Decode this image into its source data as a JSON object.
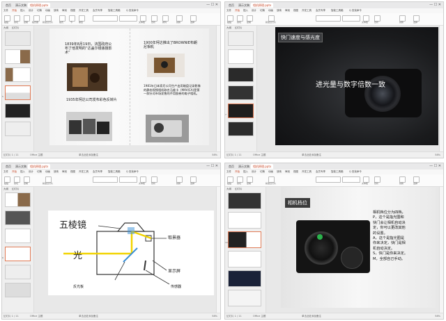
{
  "window": {
    "tabs": [
      {
        "label": "首页"
      },
      {
        "label": "演示文稿"
      },
      {
        "label": "相机原理.pptx"
      }
    ],
    "controls": "— ☐ ✕"
  },
  "menus": [
    "文件",
    "开始",
    "插入",
    "设计",
    "切换",
    "动画",
    "放映",
    "审阅",
    "视图",
    "开发工具",
    "会员专享",
    "智能工具箱",
    "Q 查找命令"
  ],
  "toolbar_labels": [
    "粘贴",
    "剪切",
    "复制",
    "格式刷",
    "新建幻灯片",
    "版式",
    "节",
    "重置",
    "字体",
    "段落",
    "文本框",
    "形状",
    "排列",
    "替换",
    "选择"
  ],
  "sidebar": {
    "tab_outline": "大纲",
    "tab_slides": "幻灯片"
  },
  "status": {
    "slide": "幻灯片 1 / 11",
    "theme": "Office 主题",
    "note": "单击此处添加备注",
    "zoom": "58%"
  },
  "q1": {
    "current": "5",
    "captions": [
      "1839年8月19日，法国政府公布了他发明的“达盖尔银版摄影术”",
      "1900年柯达推出了BROWNIE布朗尼相机",
      "1935年柯达公司发布彩色反转片",
      "1981年日本索尼公司生产出用磁盘记录影像的静态视频相机取名马维卡（MAVICA)是第一款针对市场发售的不用胶卷的电子相机。"
    ]
  },
  "q2": {
    "current": "7",
    "title": "快门速度与感光度",
    "subtitle": "进光量与数字倍数一致"
  },
  "q3": {
    "current": "6",
    "labels": {
      "pentaprism": "五棱镜",
      "light": "光",
      "viewfinder": "取景器",
      "display": "显示屏",
      "mirror": "反光板",
      "sensor": "传感器"
    }
  },
  "q4": {
    "current": "10",
    "title": "相机档位",
    "body_lines": [
      "相机档位分为四档，",
      "P，这个是指光圈和",
      "快门会让相机自动决",
      "定，你可以更改其他",
      "的设置。",
      "A，这个是指光圈是",
      "你来决定，快门是相",
      "机自动决定。",
      "S，快门是你来决定。",
      "M，全部自己手动。"
    ]
  },
  "colors": {
    "accent": "#c94a2a",
    "thumb_selected": "#e07a55",
    "diagram_yellow": "#f2d400",
    "diagram_blue": "#3a8fd6"
  }
}
